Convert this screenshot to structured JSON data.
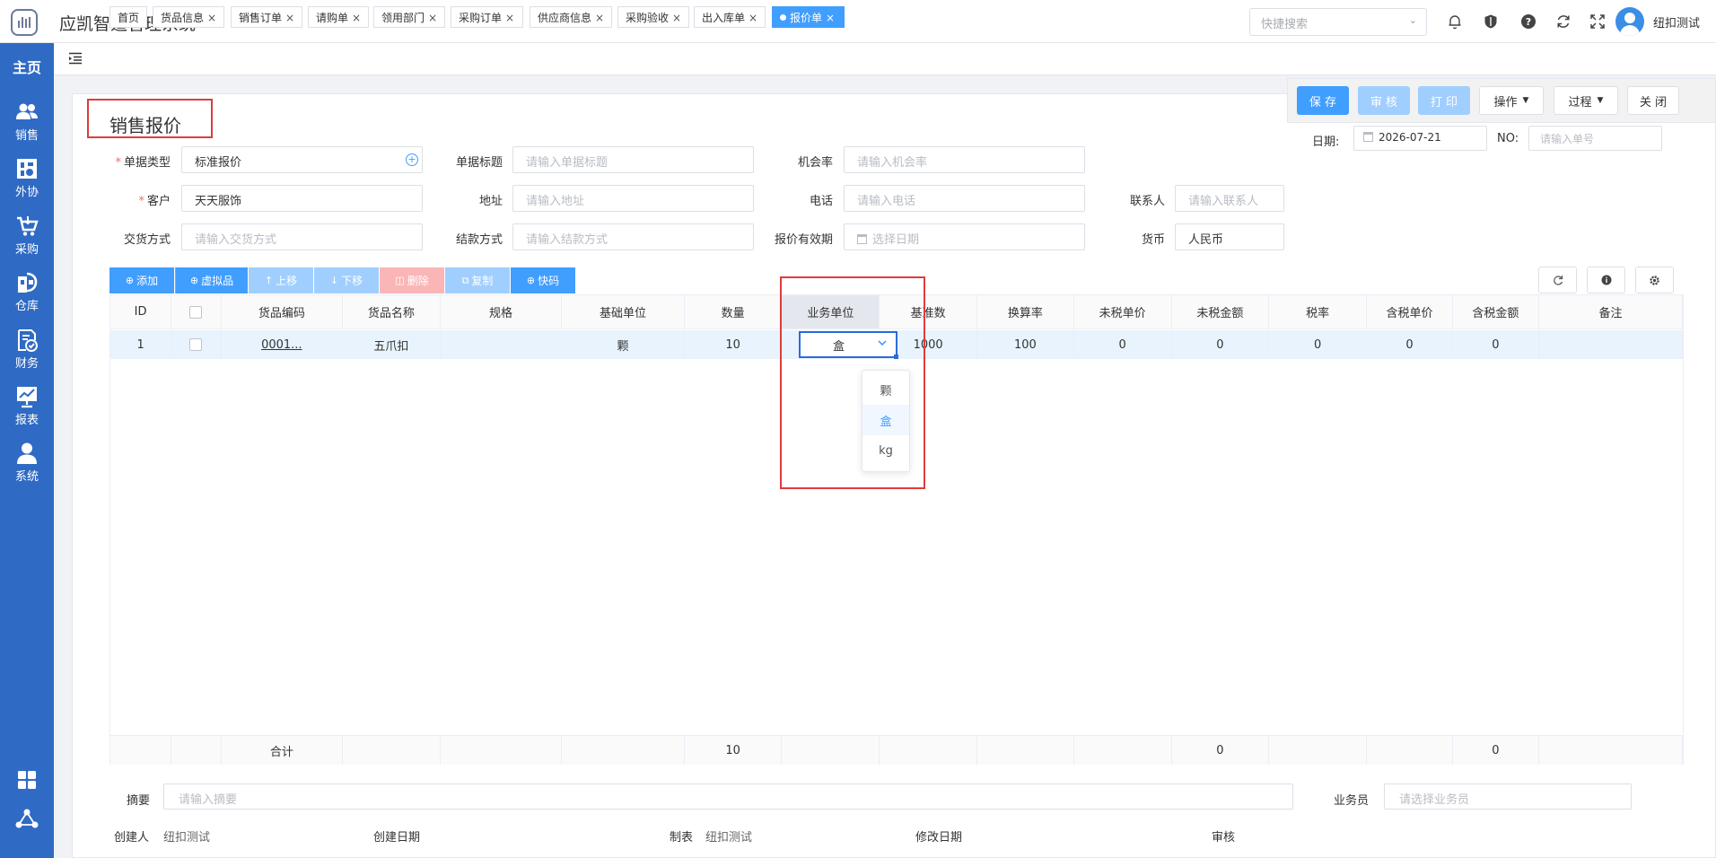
{
  "app": {
    "title": "应凯智造管理系统",
    "search_placeholder": "快捷搜索",
    "user_name": "纽扣测试"
  },
  "sidebar": {
    "home": "主页",
    "items": [
      {
        "label": "销售",
        "icon": "sales-icon"
      },
      {
        "label": "外协",
        "icon": "outsource-icon"
      },
      {
        "label": "采购",
        "icon": "purchase-icon"
      },
      {
        "label": "仓库",
        "icon": "warehouse-icon"
      },
      {
        "label": "财务",
        "icon": "finance-icon"
      },
      {
        "label": "报表",
        "icon": "report-icon"
      },
      {
        "label": "系统",
        "icon": "system-icon"
      }
    ]
  },
  "tabs": [
    {
      "label": "首页"
    },
    {
      "label": "货品信息"
    },
    {
      "label": "销售订单"
    },
    {
      "label": "请购单"
    },
    {
      "label": "领用部门"
    },
    {
      "label": "采购订单"
    },
    {
      "label": "供应商信息"
    },
    {
      "label": "采购验收"
    },
    {
      "label": "出入库单"
    },
    {
      "label": "报价单",
      "active": true
    }
  ],
  "actions": {
    "save": "保 存",
    "audit": "审 核",
    "print": "打 印",
    "operate": "操作",
    "process": "过程",
    "close": "关 闭"
  },
  "page": {
    "title": "销售报价",
    "date_label": "日期:",
    "date_value": "2026-07-21",
    "no_label": "NO:",
    "no_placeholder": "请输入单号"
  },
  "form": {
    "doc_type_label": "单据类型",
    "doc_type_value": "标准报价",
    "doc_title_label": "单据标题",
    "doc_title_placeholder": "请输入单据标题",
    "chance_label": "机会率",
    "chance_placeholder": "请输入机会率",
    "customer_label": "客户",
    "customer_value": "天天服饰",
    "address_label": "地址",
    "address_placeholder": "请输入地址",
    "phone_label": "电话",
    "phone_placeholder": "请输入电话",
    "contact_label": "联系人",
    "contact_placeholder": "请输入联系人",
    "delivery_label": "交货方式",
    "delivery_placeholder": "请输入交货方式",
    "payment_label": "结款方式",
    "payment_placeholder": "请输入结款方式",
    "validity_label": "报价有效期",
    "validity_placeholder": "选择日期",
    "currency_label": "货币",
    "currency_value": "人民币"
  },
  "table_toolbar": {
    "add": "添加",
    "virtual": "虚拟品",
    "up": "上移",
    "down": "下移",
    "delete": "删除",
    "copy": "复制",
    "quick": "快码"
  },
  "table": {
    "columns": [
      "ID",
      "",
      "货品编码",
      "货品名称",
      "规格",
      "基础单位",
      "数量",
      "业务单位",
      "基准数",
      "换算率",
      "未税单价",
      "未税金额",
      "税率",
      "含税单价",
      "含税金额",
      "备注"
    ],
    "rows": [
      [
        "1",
        "",
        "0001...",
        "五爪扣",
        "",
        "颗",
        "10",
        "盒",
        "1000",
        "100",
        "0",
        "0",
        "0",
        "0",
        "0",
        ""
      ]
    ],
    "footer": [
      "",
      "",
      "合计",
      "",
      "",
      "",
      "10",
      "",
      "",
      "",
      "",
      "0",
      "",
      "",
      "0",
      ""
    ]
  },
  "unit_dropdown": {
    "options": [
      "颗",
      "盒",
      "kg"
    ],
    "selected": "盒"
  },
  "bottom": {
    "summary_label": "摘要",
    "summary_placeholder": "请输入摘要",
    "salesperson_label": "业务员",
    "salesperson_placeholder": "请选择业务员",
    "creator_label": "创建人",
    "creator_value": "纽扣测试",
    "created_date_label": "创建日期",
    "maker_label": "制表",
    "maker_value": "纽扣测试",
    "modified_date_label": "修改日期",
    "auditor_label": "审核"
  },
  "colors": {
    "sidebar": "#2f6bc4",
    "primary": "#409eff",
    "primary_light": "#a0cfff",
    "danger_light": "#fab6b6",
    "highlight_box": "#e03c3c"
  }
}
